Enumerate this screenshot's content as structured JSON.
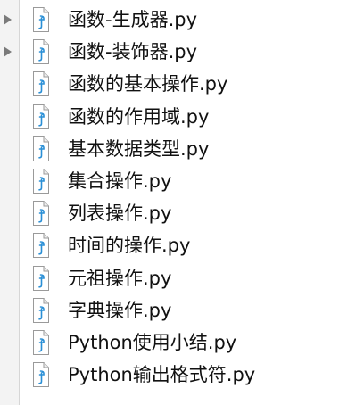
{
  "file_browser": {
    "items": [
      {
        "name": "函数-生成器.py",
        "expandable": true
      },
      {
        "name": "函数-装饰器.py",
        "expandable": true
      },
      {
        "name": "函数的基本操作.py",
        "expandable": false
      },
      {
        "name": "函数的作用域.py",
        "expandable": false
      },
      {
        "name": "基本数据类型.py",
        "expandable": false
      },
      {
        "name": "集合操作.py",
        "expandable": false
      },
      {
        "name": "列表操作.py",
        "expandable": false
      },
      {
        "name": "时间的操作.py",
        "expandable": false
      },
      {
        "name": "元祖操作.py",
        "expandable": false
      },
      {
        "name": "字典操作.py",
        "expandable": false
      },
      {
        "name": "Python使用小结.py",
        "expandable": false
      },
      {
        "name": "Python输出格式符.py",
        "expandable": false
      }
    ],
    "icon": "python-file-icon",
    "colors": {
      "icon_accent": "#2a8fd6",
      "disclosure": "#7a7a7a",
      "text": "#111111"
    }
  }
}
